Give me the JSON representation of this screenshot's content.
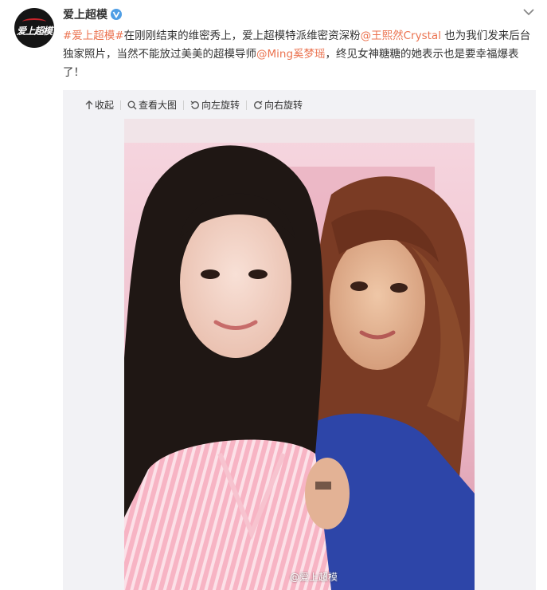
{
  "post": {
    "username": "爱上超模",
    "avatar_logo_text": "爱上超模",
    "text_parts": {
      "hashtag": "#爱上超模#",
      "part1": "在刚刚结束的维密秀上，爱上超模特派维密资深粉",
      "mention1": "@王熙然Crystal",
      "part2": " 也为我们发来后台独家照片，当然不能放过美美的超模导师",
      "mention2": "@Ming奚梦瑶",
      "part3": "，终见女神糖糖的她表示也是要幸福爆表了！"
    }
  },
  "toolbar": {
    "collapse": "收起",
    "view_large": "查看大图",
    "rotate_left": "向左旋转",
    "rotate_right": "向右旋转"
  },
  "photo": {
    "watermark": "@爱上超模"
  },
  "colors": {
    "link": "#eb7350",
    "verified": "#4f9ee5",
    "media_bg": "#f2f2f5"
  }
}
